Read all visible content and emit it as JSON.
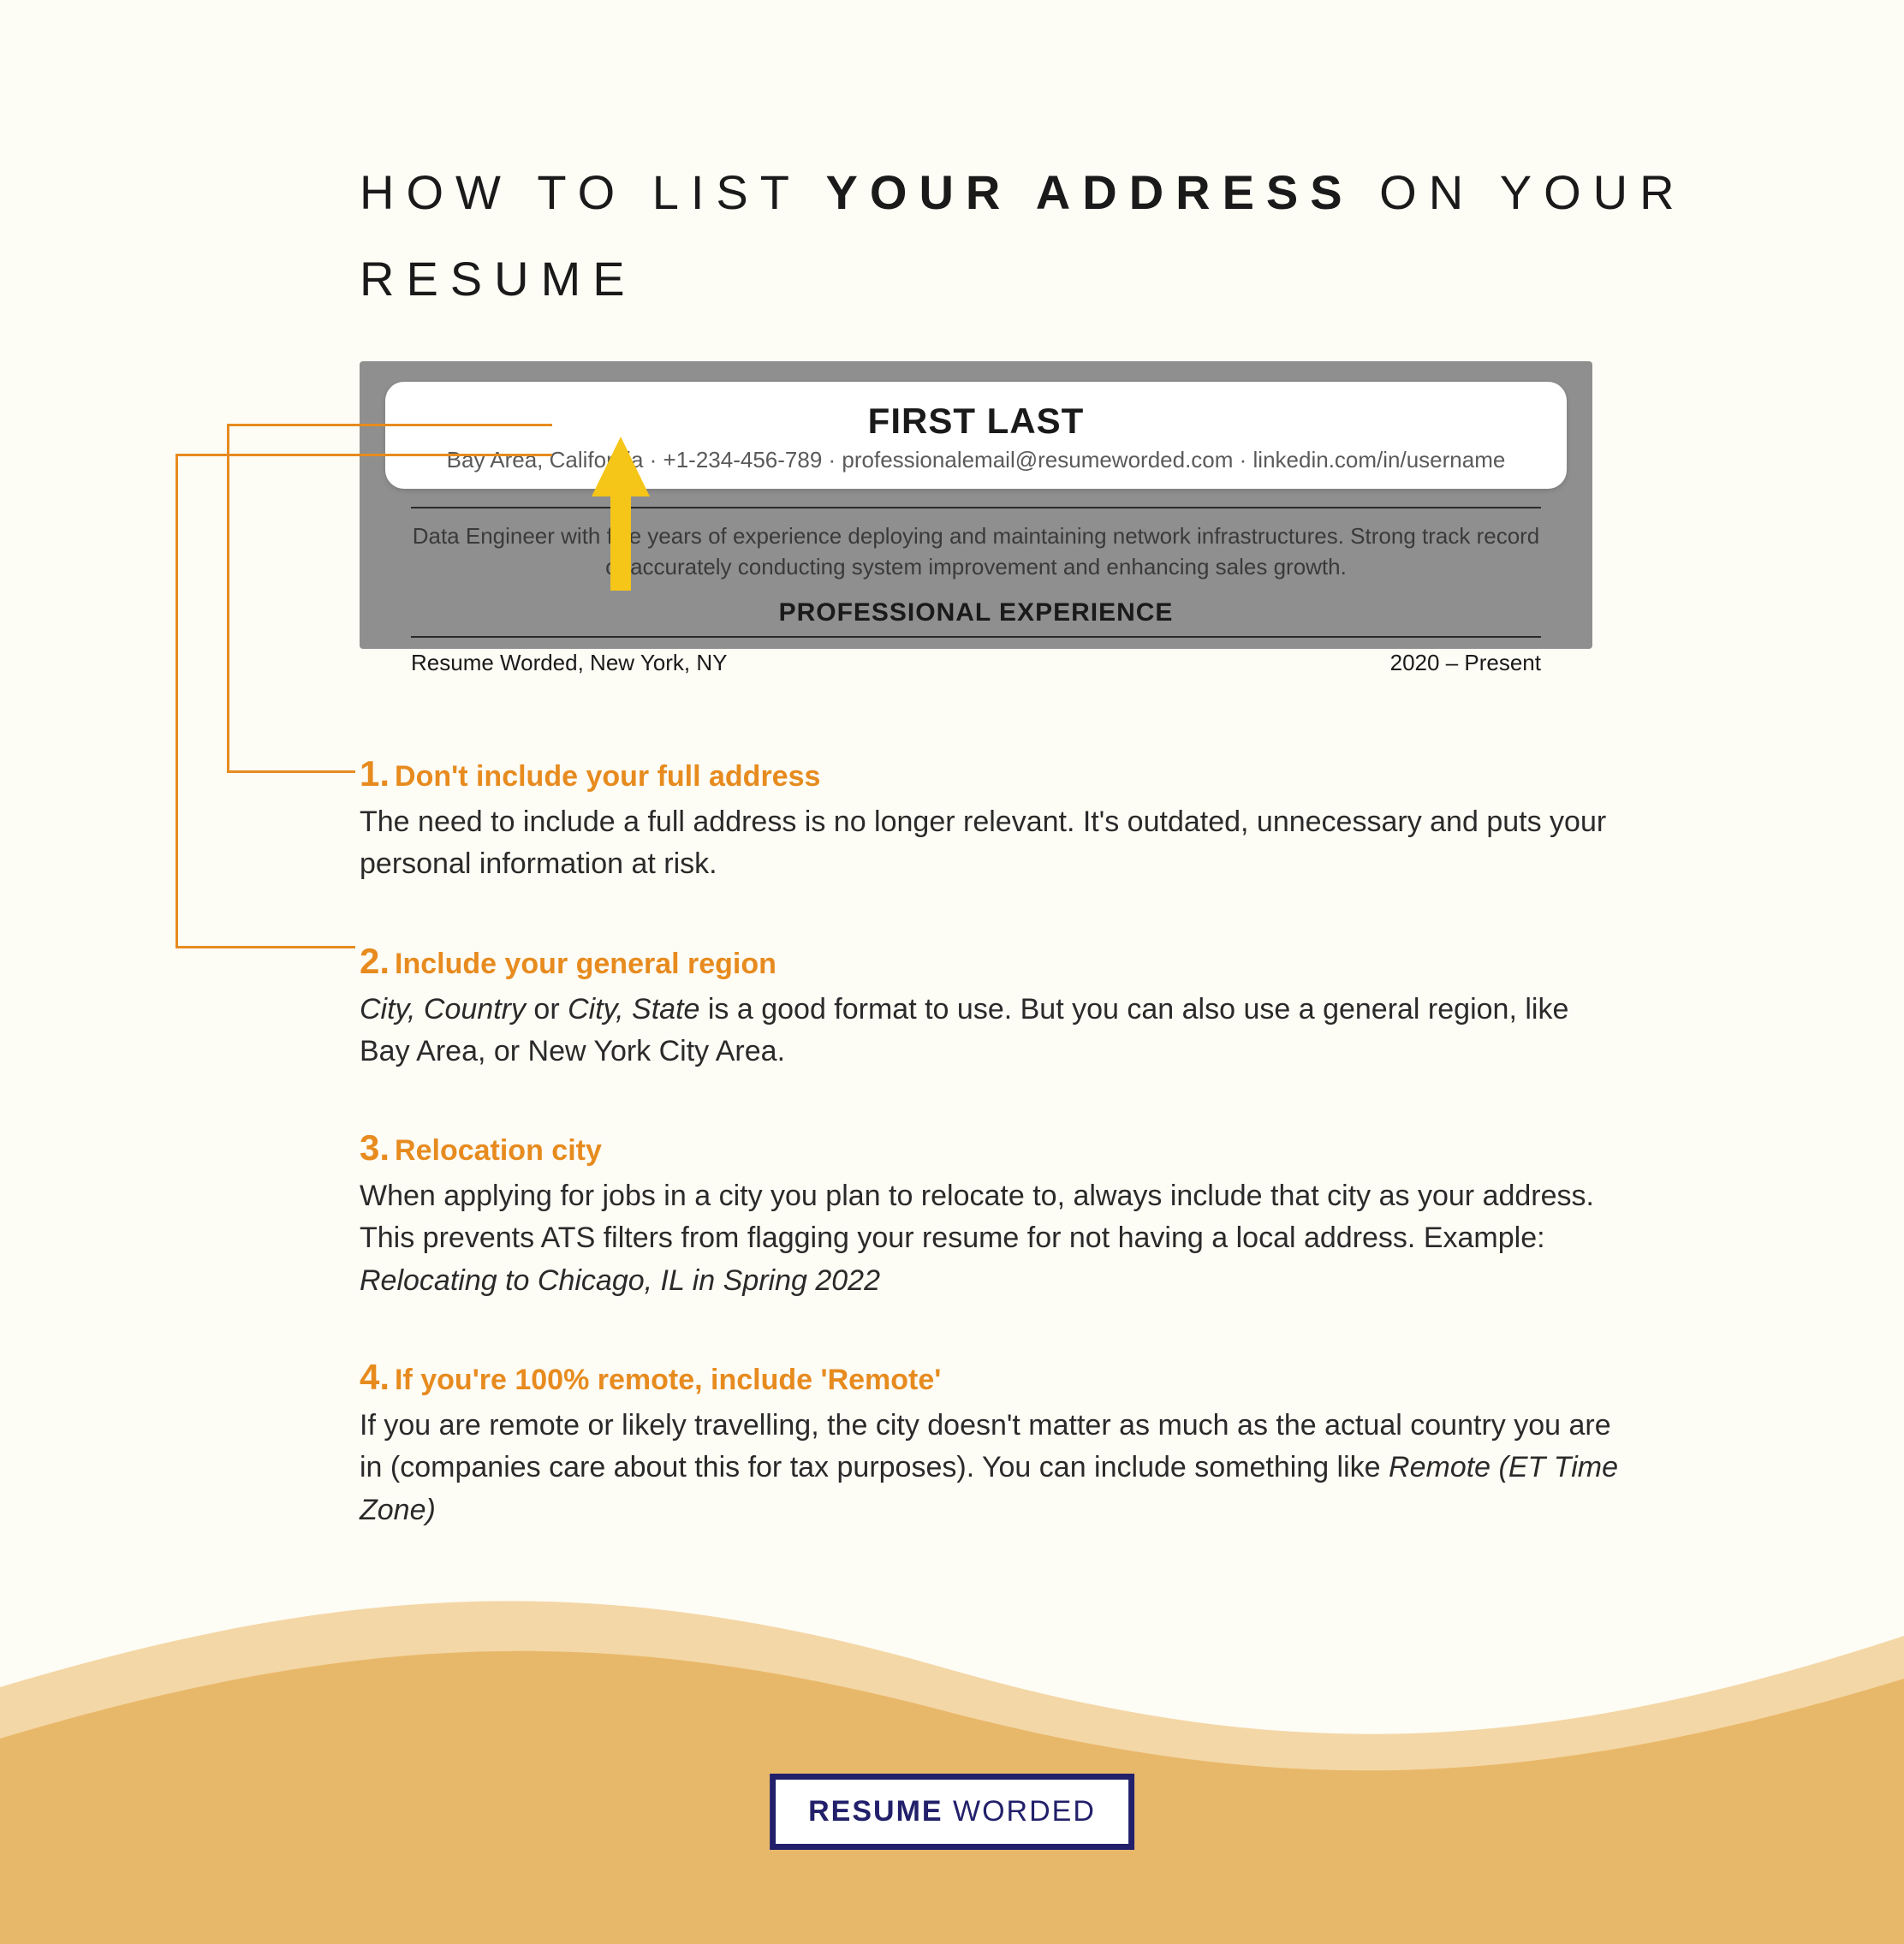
{
  "title": {
    "pre": "HOW TO LIST ",
    "bold": "YOUR ADDRESS",
    "post": " ON YOUR RESUME"
  },
  "sample": {
    "name": "FIRST LAST",
    "contact": "Bay Area, California · +1-234-456-789 · professionalemail@resumeworded.com · linkedin.com/in/username",
    "summary": "Data Engineer with five years of experience deploying and maintaining network infrastructures. Strong track record of accurately conducting system improvement and enhancing sales growth.",
    "section": "PROFESSIONAL EXPERIENCE",
    "row_left": "Resume Worded, New York, NY",
    "row_right": "2020 – Present"
  },
  "tips": [
    {
      "num": "1.",
      "head": "Don't include your full address",
      "body_plain": "The need to include a full address is no longer relevant. It's outdated, unnecessary and puts your personal information at risk."
    },
    {
      "num": "2.",
      "head": "Include your general region",
      "body_html": "<span class=\"ital\">City, Country</span> or <span class=\"ital\">City, State</span>  is a good format to use. But you can also use a general region, like Bay Area, or New York City Area."
    },
    {
      "num": "3.",
      "head": "Relocation city",
      "body_html": "When applying for jobs in a city you plan to relocate to, always include that city as your address. This prevents ATS filters from flagging your resume for not having a local address. Example: <span class=\"ital\">Relocating to Chicago, IL in Spring 2022</span>"
    },
    {
      "num": "4.",
      "head": "If you're 100% remote, include 'Remote'",
      "body_html": "If you are remote or likely travelling, the city doesn't matter as much as the actual country you are in (companies care about this for tax purposes). You can include something like <span class=\"ital\">Remote (ET Time Zone)</span>"
    }
  ],
  "logo": {
    "bold": "RESUME",
    "rest": " WORDED"
  }
}
